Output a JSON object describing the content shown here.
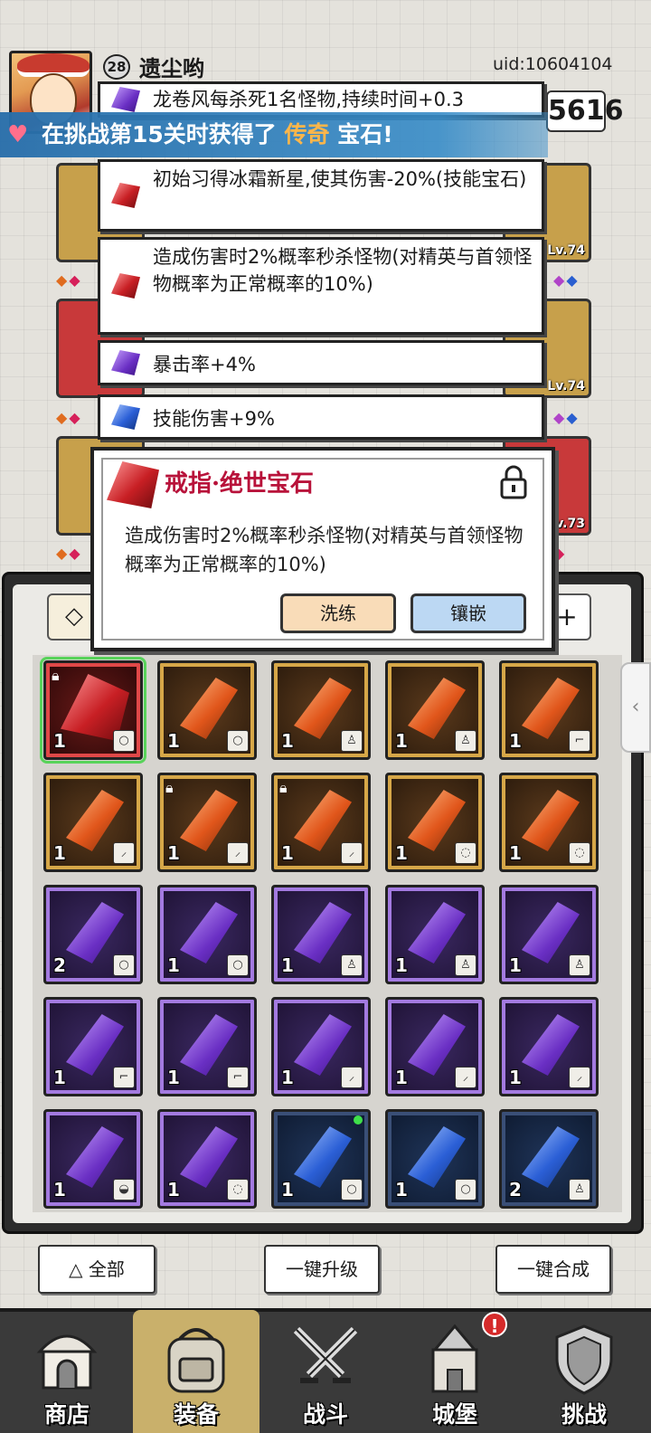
{
  "player": {
    "level": "28",
    "name": "遗尘哟",
    "uid": "uid:10604104",
    "power": "5616"
  },
  "banner": {
    "prefix": "在挑战第15关时获得了",
    "highlight": "传奇",
    "suffix": "宝石!"
  },
  "equipment_levels": [
    "Lv.74",
    "Lv.74",
    "Lv.73"
  ],
  "effects": [
    {
      "gem": "purple",
      "text": "龙卷风每杀死1名怪物,持续时间+0.3"
    },
    {
      "gem": "red",
      "text": "初始习得冰霜新星,使其伤害-20%(技能宝石)"
    },
    {
      "gem": "red",
      "text": "造成伤害时2%概率秒杀怪物(对精英与首领怪物概率为正常概率的10%)"
    },
    {
      "gem": "purple",
      "text": "暴击率+4%"
    },
    {
      "gem": "blue",
      "text": "技能伤害+9%"
    }
  ],
  "popup": {
    "title": "戒指·绝世宝石",
    "description": "造成伤害时2%概率秒杀怪物(对精英与首领怪物概率为正常概率的10%)",
    "refine_label": "洗练",
    "inlay_label": "镶嵌"
  },
  "inventory": [
    {
      "rarity": "red",
      "count": "1",
      "slot": "ring",
      "locked": true,
      "selected": true
    },
    {
      "rarity": "orange",
      "count": "1",
      "slot": "ring"
    },
    {
      "rarity": "orange",
      "count": "1",
      "slot": "armor"
    },
    {
      "rarity": "orange",
      "count": "1",
      "slot": "armor"
    },
    {
      "rarity": "orange",
      "count": "1",
      "slot": "boots"
    },
    {
      "rarity": "orange",
      "count": "1",
      "slot": "weapon"
    },
    {
      "rarity": "orange",
      "count": "1",
      "slot": "weapon",
      "locked": true
    },
    {
      "rarity": "orange",
      "count": "1",
      "slot": "weapon",
      "locked": true
    },
    {
      "rarity": "orange",
      "count": "1",
      "slot": "necklace"
    },
    {
      "rarity": "orange",
      "count": "1",
      "slot": "necklace"
    },
    {
      "rarity": "purple",
      "count": "2",
      "slot": "ring"
    },
    {
      "rarity": "purple",
      "count": "1",
      "slot": "ring"
    },
    {
      "rarity": "purple",
      "count": "1",
      "slot": "armor"
    },
    {
      "rarity": "purple",
      "count": "1",
      "slot": "armor"
    },
    {
      "rarity": "purple",
      "count": "1",
      "slot": "armor"
    },
    {
      "rarity": "purple",
      "count": "1",
      "slot": "boots"
    },
    {
      "rarity": "purple",
      "count": "1",
      "slot": "boots"
    },
    {
      "rarity": "purple",
      "count": "1",
      "slot": "weapon"
    },
    {
      "rarity": "purple",
      "count": "1",
      "slot": "weapon"
    },
    {
      "rarity": "purple",
      "count": "1",
      "slot": "weapon"
    },
    {
      "rarity": "purple",
      "count": "1",
      "slot": "helmet"
    },
    {
      "rarity": "purple",
      "count": "1",
      "slot": "necklace"
    },
    {
      "rarity": "blue",
      "count": "1",
      "slot": "ring",
      "new": true
    },
    {
      "rarity": "blue",
      "count": "1",
      "slot": "ring"
    },
    {
      "rarity": "blue",
      "count": "2",
      "slot": "armor"
    }
  ],
  "bottom_buttons": {
    "filter_label": "全部",
    "upgrade_label": "一键升级",
    "merge_label": "一键合成"
  },
  "nav": [
    {
      "label": "商店",
      "icon": "shop-icon"
    },
    {
      "label": "装备",
      "icon": "bag-icon",
      "active": true
    },
    {
      "label": "战斗",
      "icon": "swords-icon"
    },
    {
      "label": "城堡",
      "icon": "castle-icon",
      "badge": "!"
    },
    {
      "label": "挑战",
      "icon": "shield-icon"
    }
  ],
  "colors": {
    "banner_blue": "#2e7bb8",
    "legend_orange": "#ffb64a",
    "popup_title_red": "#b8123a",
    "selected_green": "#58d35a"
  }
}
